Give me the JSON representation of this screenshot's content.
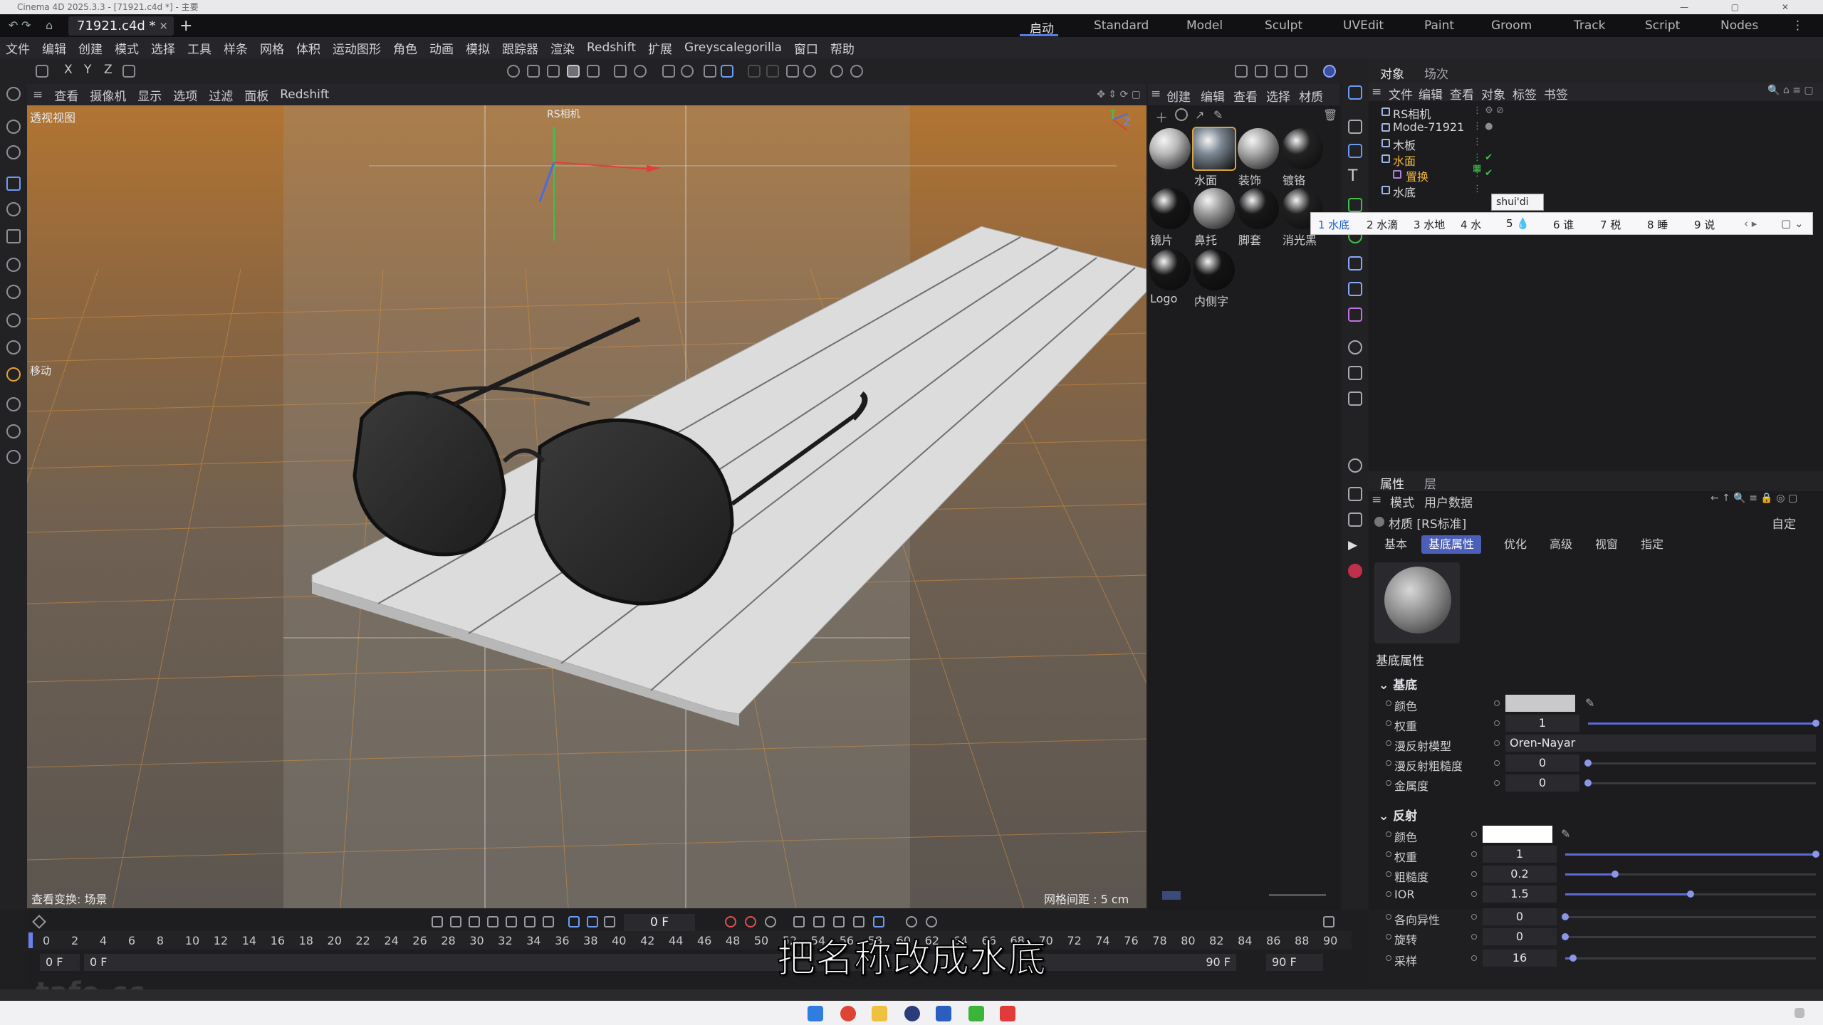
{
  "window": {
    "title": "Cinema 4D 2025.3.3 - [71921.c4d *] - 主要"
  },
  "tabs": {
    "document": "71921.c4d *",
    "close": "×",
    "new": "+"
  },
  "layouts": [
    "启动",
    "Standard",
    "Model",
    "Sculpt",
    "UVEdit",
    "Paint",
    "Groom",
    "Track",
    "Script",
    "Nodes"
  ],
  "menu": [
    "文件",
    "编辑",
    "创建",
    "模式",
    "选择",
    "工具",
    "样条",
    "网格",
    "体积",
    "运动图形",
    "角色",
    "动画",
    "模拟",
    "跟踪器",
    "渲染",
    "Redshift",
    "扩展",
    "Greyscalegorilla",
    "窗口",
    "帮助"
  ],
  "toolbar": {
    "axis_x": "X",
    "axis_y": "Y",
    "axis_z": "Z"
  },
  "viewport": {
    "menu": [
      "查看",
      "摄像机",
      "显示",
      "选项",
      "过滤",
      "面板",
      "Redshift"
    ],
    "name": "透视视图",
    "camera_label": "RS相机",
    "move_label": "移动",
    "transform_label": "查看变换: 场景",
    "grid_label": "网格间距 : 5 cm",
    "axis_y": "Y",
    "axis_z": "Z"
  },
  "materials": {
    "menu": [
      "创建",
      "编辑",
      "查看",
      "选择",
      "材质"
    ],
    "items": [
      {
        "label": "",
        "color": "#b8b8b8"
      },
      {
        "label": "水面",
        "color": "#7c8894"
      },
      {
        "label": "装饰",
        "color": "#a9a9a9"
      },
      {
        "label": "镀铬",
        "color": "#222222"
      },
      {
        "label": "镜片",
        "color": "#151515"
      },
      {
        "label": "鼻托",
        "color": "#9a9a9a"
      },
      {
        "label": "脚套",
        "color": "#181818"
      },
      {
        "label": "消光黑",
        "color": "#202020"
      },
      {
        "label": "Logo",
        "color": "#161616"
      },
      {
        "label": "内侧字",
        "color": "#141414"
      }
    ]
  },
  "objects": {
    "tabs": [
      "对象",
      "场次"
    ],
    "menu": [
      "文件",
      "编辑",
      "查看",
      "对象",
      "标签",
      "书签"
    ],
    "items": [
      {
        "name": "RS相机"
      },
      {
        "name": "Mode-71921"
      },
      {
        "name": "木板"
      },
      {
        "name": "水面"
      },
      {
        "name": "置换"
      },
      {
        "name": "水底"
      }
    ]
  },
  "ime": {
    "input": "shui'di",
    "candidates": [
      "1 水底",
      "2 水滴",
      "3 水地",
      "4 水",
      "5 💧",
      "6 谁",
      "7 税",
      "8 睡",
      "9 说"
    ]
  },
  "attributes": {
    "tabs": [
      "属性",
      "层"
    ],
    "sub": [
      "模式",
      "用户数据"
    ],
    "material_label": "材质 [RS标准]",
    "preset": "自定",
    "material_tabs": [
      "基本",
      "基底属性",
      "优化",
      "高级",
      "视窗",
      "指定"
    ],
    "heading": "基底属性",
    "base_section": "基底",
    "base_props": [
      {
        "label": "颜色",
        "value": ""
      },
      {
        "label": "权重",
        "value": "1",
        "fill": 1
      },
      {
        "label": "漫反射模型",
        "value": "Oren-Nayar"
      },
      {
        "label": "漫反射粗糙度",
        "value": "0",
        "fill": 0
      },
      {
        "label": "金属度",
        "value": "0",
        "fill": 0
      }
    ],
    "refl_section": "反射",
    "refl_props": [
      {
        "label": "颜色",
        "value": ""
      },
      {
        "label": "权重",
        "value": "1",
        "fill": 1
      },
      {
        "label": "粗糙度",
        "value": "0.2",
        "fill": 0.2
      },
      {
        "label": "IOR",
        "value": "1.5",
        "fill": 0.5
      },
      {
        "label": "各向异性",
        "value": "0",
        "fill": 0
      },
      {
        "label": "旋转",
        "value": "0",
        "fill": 0
      },
      {
        "label": "采样",
        "value": "16",
        "fill": 0.03
      }
    ]
  },
  "timeline": {
    "ticks": [
      "0",
      "2",
      "4",
      "6",
      "8",
      "10",
      "12",
      "14",
      "16",
      "18",
      "20",
      "22",
      "24",
      "26",
      "28",
      "30",
      "32",
      "34",
      "36",
      "38",
      "40",
      "42",
      "44",
      "46",
      "48",
      "50",
      "52",
      "54",
      "56",
      "58",
      "60",
      "62",
      "64",
      "66",
      "68",
      "70",
      "72",
      "74",
      "76",
      "78",
      "80",
      "82",
      "84",
      "86",
      "88",
      "90"
    ],
    "current_frame": "0 F",
    "start": "0 F",
    "start2": "0 F",
    "end": "90 F",
    "end2": "90 F"
  },
  "subtitle": "把名称改成水底",
  "watermark": "tafe.cc"
}
